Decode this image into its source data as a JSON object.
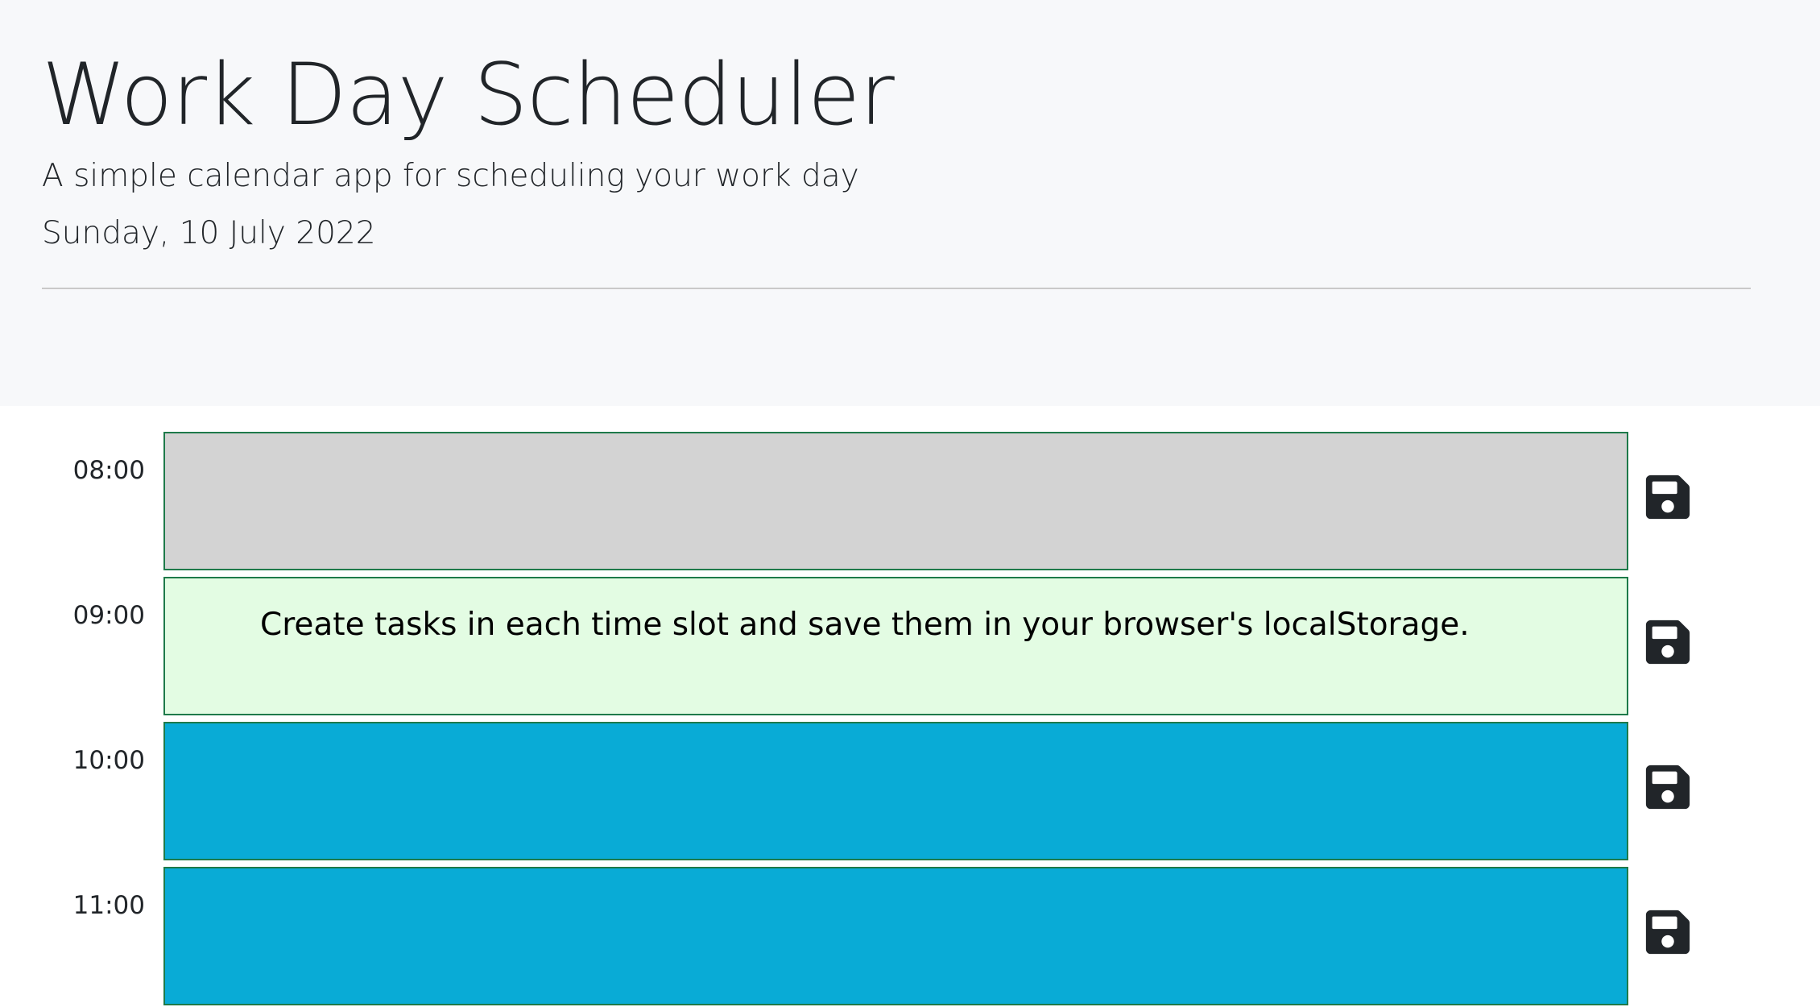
{
  "header": {
    "title": "Work Day Scheduler",
    "lead": "A simple calendar app for scheduling your work day",
    "current_day": "Sunday, 10 July 2022"
  },
  "colors": {
    "past": "#d3d3d3",
    "present": "#e3fce3",
    "future": "#09abd6",
    "border": "#1e7a4a",
    "save_icon": "#212529"
  },
  "time_blocks": [
    {
      "hour": "08:00",
      "text": "",
      "state": "past",
      "icon": "floppy-disk-icon"
    },
    {
      "hour": "09:00",
      "text": "Create tasks in each time slot and save them in your browser's localStorage.",
      "state": "present",
      "icon": "floppy-disk-icon"
    },
    {
      "hour": "10:00",
      "text": "",
      "state": "future",
      "icon": "floppy-disk-icon"
    },
    {
      "hour": "11:00",
      "text": "",
      "state": "future",
      "icon": "floppy-disk-icon"
    }
  ]
}
